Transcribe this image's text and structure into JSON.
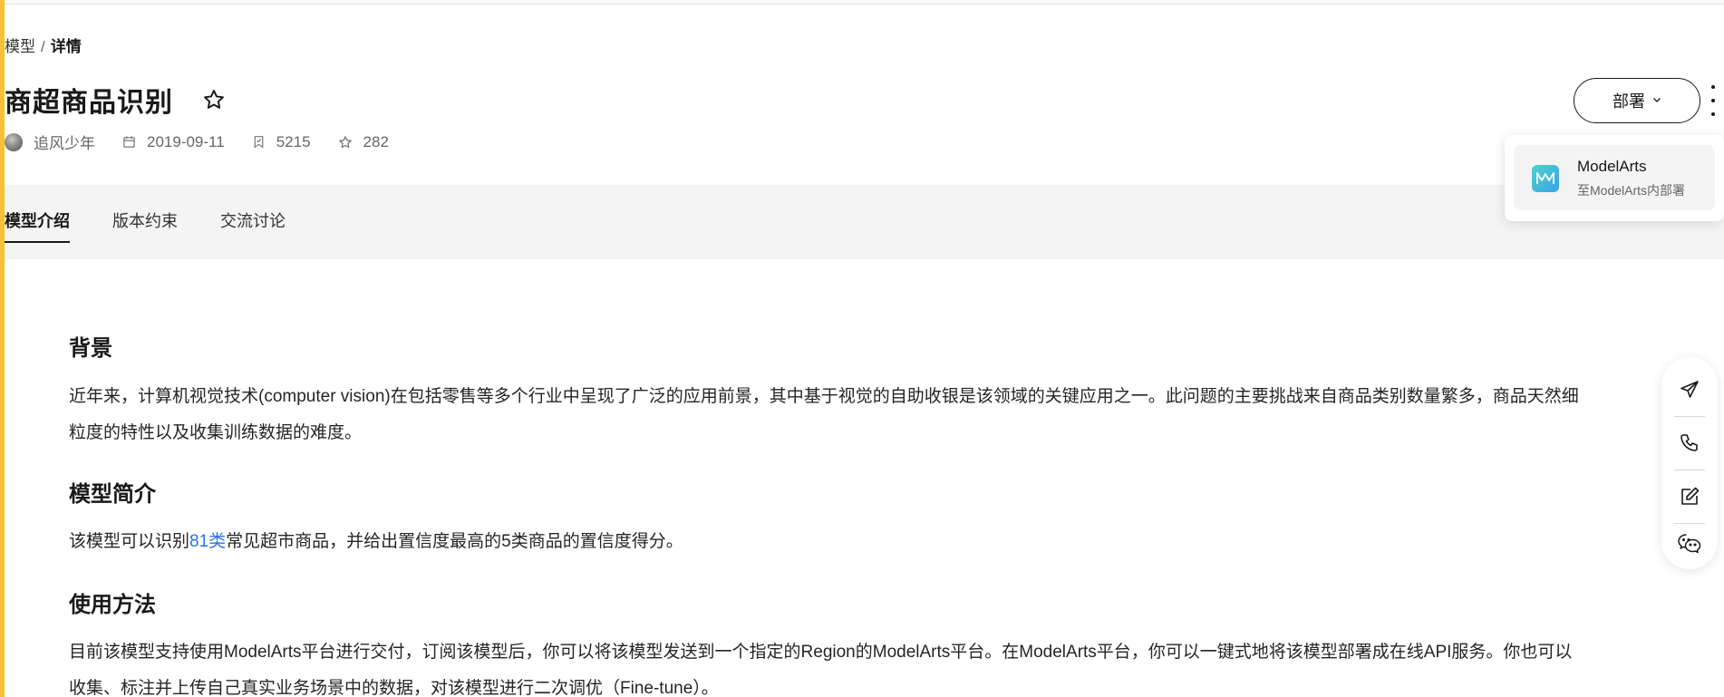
{
  "breadcrumb": {
    "parent": "模型",
    "separator": "/",
    "current": "详情"
  },
  "model": {
    "title": "商超商品识别",
    "author": "追风少年",
    "date": "2019-09-11",
    "subscriptions": "5215",
    "favorites": "282"
  },
  "actions": {
    "deploy_label": "部署"
  },
  "dropdown": {
    "title": "ModelArts",
    "subtitle": "至ModelArts内部署"
  },
  "tabs": [
    {
      "label": "模型介绍",
      "active": true
    },
    {
      "label": "版本约束",
      "active": false
    },
    {
      "label": "交流讨论",
      "active": false
    }
  ],
  "content": {
    "background_heading": "背景",
    "background_text_line1": "近年来，计算机视觉技术(computer vision)在包括零售等多个行业中呈现了广泛的应用前景，其中基于视觉的自助收银是该领域的关键应用之一。此问题的主要挑战来自商品类别数量繁多，商品天然细",
    "background_text_line2": "粒度的特性以及收集训练数据的难度。",
    "intro_heading": "模型简介",
    "intro_prefix": "该模型可以识别",
    "intro_link": "81类",
    "intro_suffix": "常见超市商品，并给出置信度最高的5类商品的置信度得分。",
    "usage_heading": "使用方法",
    "usage_text_line1": "目前该模型支持使用ModelArts平台进行交付，订阅该模型后，你可以将该模型发送到一个指定的Region的ModelArts平台。在ModelArts平台，你可以一键式地将该模型部署成在线API服务。你也可以",
    "usage_text_line2": "收集、标注并上传自己真实业务场景中的数据，对该模型进行二次调优（Fine-tune）。"
  },
  "icons": {
    "star": "star-icon",
    "calendar": "calendar-icon",
    "subscribe": "bookmark-icon",
    "favorite": "star-outline-icon",
    "float": [
      "send-icon",
      "phone-icon",
      "edit-icon",
      "wechat-icon"
    ]
  },
  "colors": {
    "accent": "#f6c22f",
    "link": "#2971e8"
  }
}
